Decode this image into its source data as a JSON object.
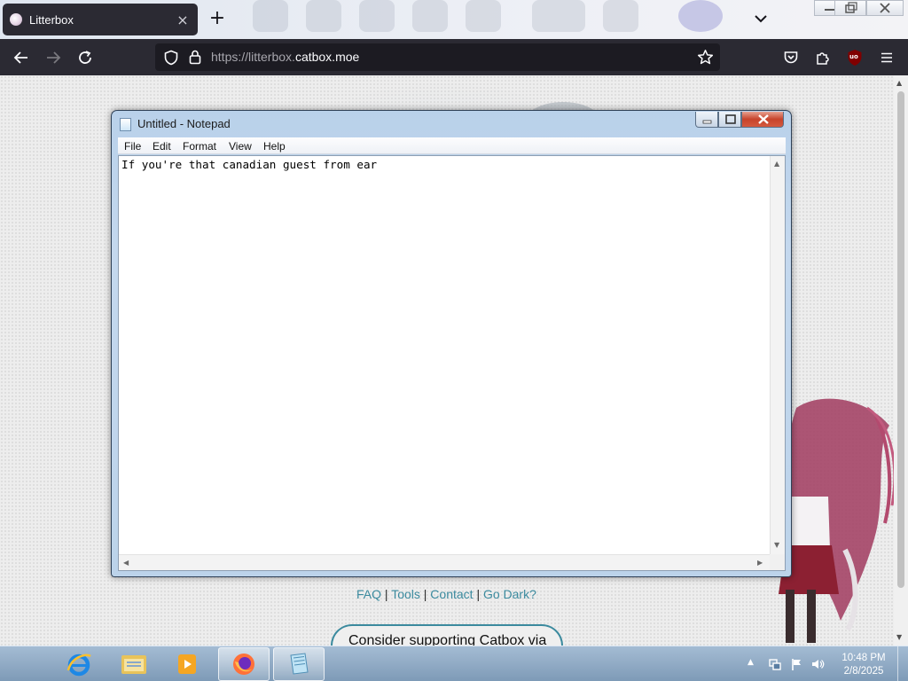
{
  "browser": {
    "tab": {
      "title": "Litterbox",
      "close_glyph": "×"
    },
    "new_tab_glyph": "+",
    "url": {
      "scheme": "https://litterbox.",
      "host": "catbox.moe"
    },
    "extension_badge": "uo"
  },
  "page": {
    "footer_links": [
      "FAQ",
      "Tools",
      "Contact",
      "Go Dark?"
    ],
    "footer_separator": "|",
    "support_text": "Consider supporting Catbox via"
  },
  "notepad": {
    "title": "Untitled - Notepad",
    "menu": [
      "File",
      "Edit",
      "Format",
      "View",
      "Help"
    ],
    "content": "If you're that canadian guest from ear"
  },
  "taskbar": {
    "apps": [
      "internet-explorer-icon",
      "file-explorer-icon",
      "media-player-icon",
      "firefox-icon",
      "notepad-icon"
    ],
    "clock_time": "10:48 PM",
    "clock_date": "2/8/2025"
  },
  "colors": {
    "browser_chrome": "#2b2a33",
    "link": "#3b8a9e",
    "notepad_frame": "#b9d1ea",
    "close_red": "#c7432b"
  }
}
